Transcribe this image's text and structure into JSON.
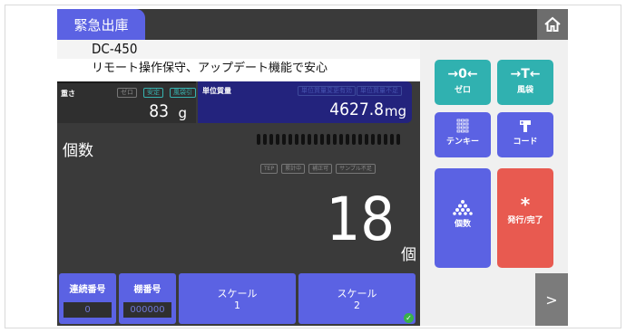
{
  "header": {
    "title": "緊急出庫",
    "home_icon": "home-icon"
  },
  "product": {
    "code": "DC-450",
    "description": "リモート操作保守、アップデート機能で安心"
  },
  "weight": {
    "label": "重さ",
    "chips": [
      "ゼロ",
      "安定",
      "風袋引"
    ],
    "value": "83",
    "unit": "g"
  },
  "unit_weight": {
    "label": "単位質量",
    "chips": [
      "単位質量変更有効",
      "単位質量不足"
    ],
    "value": "4627.8",
    "unit": "mg"
  },
  "count": {
    "label": "個数",
    "status_chips": [
      "TEP",
      "累計中",
      "補正可",
      "サンプル不足"
    ],
    "value": "18",
    "unit": "個"
  },
  "bottom": {
    "serial": {
      "label": "連続番号",
      "value": "0"
    },
    "shelf": {
      "label": "棚番号",
      "value": "000000"
    },
    "scale1": {
      "label": "スケール",
      "num": "1"
    },
    "scale2": {
      "label": "スケール",
      "num": "2"
    }
  },
  "functions": {
    "zero": {
      "icon": "→0←",
      "label": "ゼロ"
    },
    "tare": {
      "icon": "→T←",
      "label": "風袋"
    },
    "tenkey": {
      "label": "テンキー"
    },
    "code": {
      "label": "コード"
    },
    "count": {
      "label": "個数"
    },
    "issue": {
      "icon": "*",
      "label": "発行/完了"
    }
  },
  "next": ">",
  "colors": {
    "accent": "#5b62e3",
    "teal": "#30b1b0",
    "red": "#e85a50",
    "unit_box": "#23237d"
  }
}
